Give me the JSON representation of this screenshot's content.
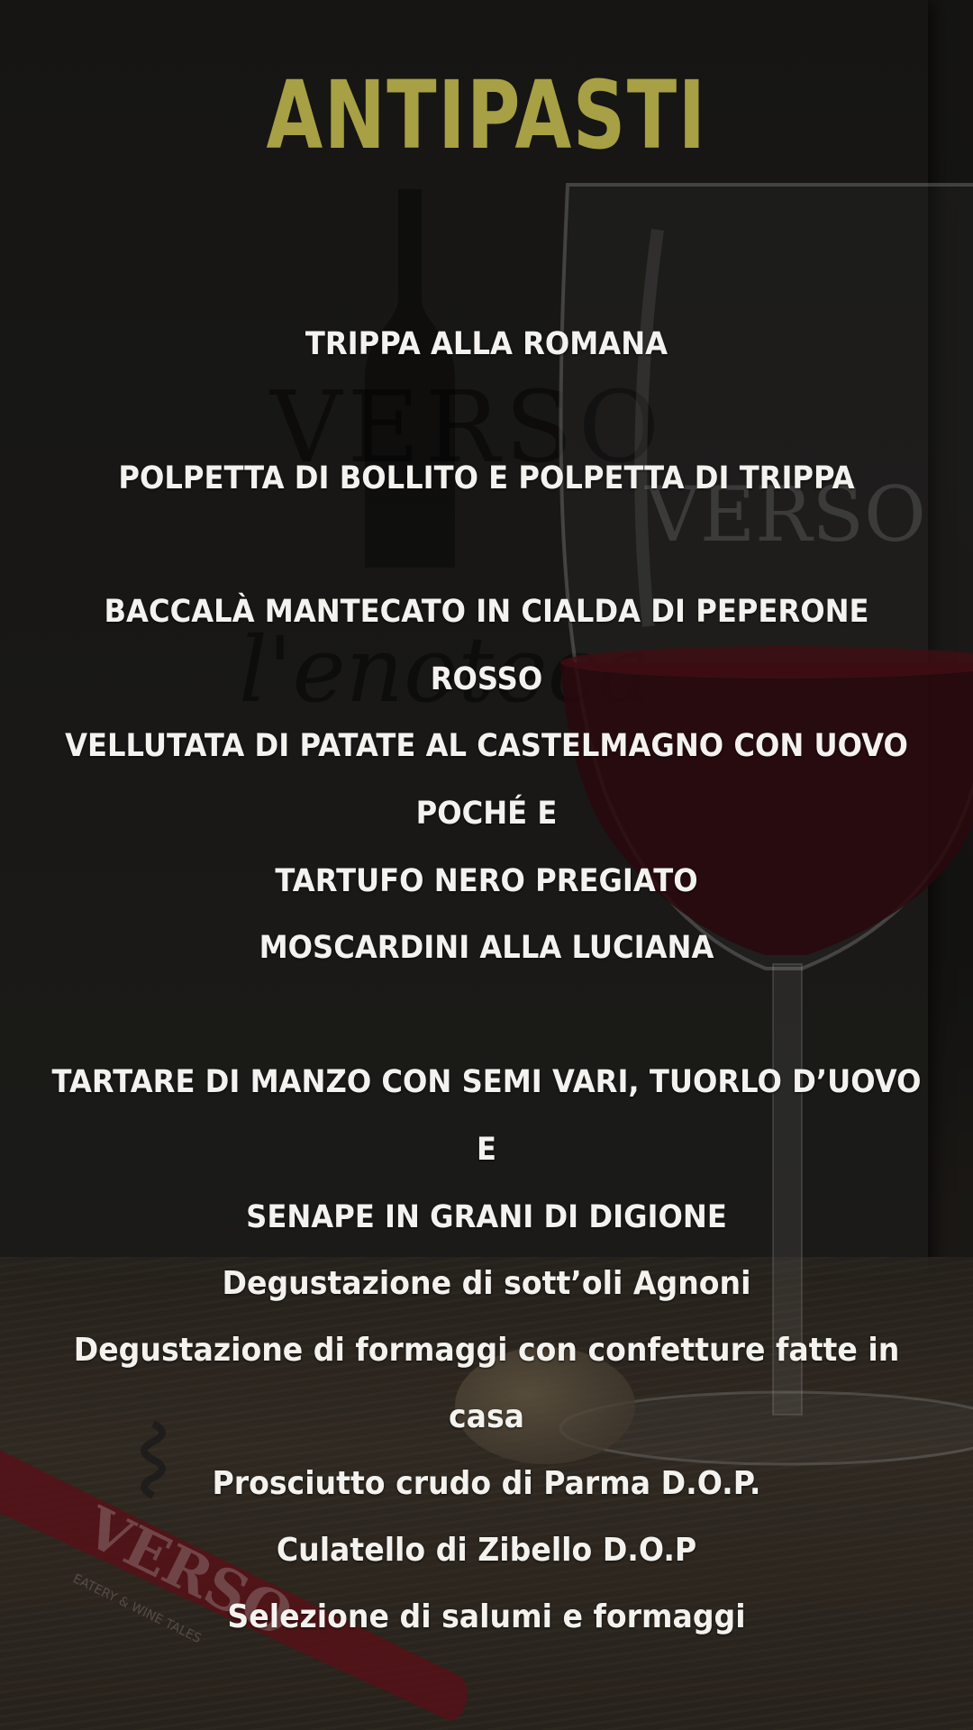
{
  "menu": {
    "title": "ANTIPASTI",
    "dishes": [
      {
        "line1": "TRIPPA ALLA ROMANA"
      },
      {
        "line1": "POLPETTA DI BOLLITO E POLPETTA DI TRIPPA"
      },
      {
        "line1": "BACCALÀ MANTECATO IN CIALDA DI PEPERONE ROSSO"
      },
      {
        "line1": "VELLUTATA DI PATATE AL CASTELMAGNO CON UOVO POCHÉ E",
        "line2": "TARTUFO NERO PREGIATO"
      },
      {
        "line1": "MOSCARDINI ALLA LUCIANA"
      },
      {
        "line1": "TARTARE DI MANZO CON SEMI VARI, TUORLO D’UOVO E",
        "line2": "SENAPE IN GRANI DI DIGIONE"
      }
    ],
    "selections": [
      "Degustazione di sott’oli Agnoni",
      "Degustazione di formaggi con confetture fatte in casa",
      "Prosciutto crudo di Parma D.O.P.",
      "Culatello di Zibello D.O.P",
      "Selezione di salumi e formaggi"
    ]
  },
  "background": {
    "box_logo": "VERSO",
    "box_script": "l'enoteca",
    "glass_logo": "VERSO",
    "cork_logo": "VERSO",
    "corkscrew_logo": "VERSO",
    "corkscrew_tagline": "EATERY & WINE TALES"
  },
  "colors": {
    "title": "#a7a044",
    "text": "#f4f2ee",
    "background": "#1a1917",
    "corkscrew": "#7a1620",
    "wine": "#3a0c12"
  }
}
